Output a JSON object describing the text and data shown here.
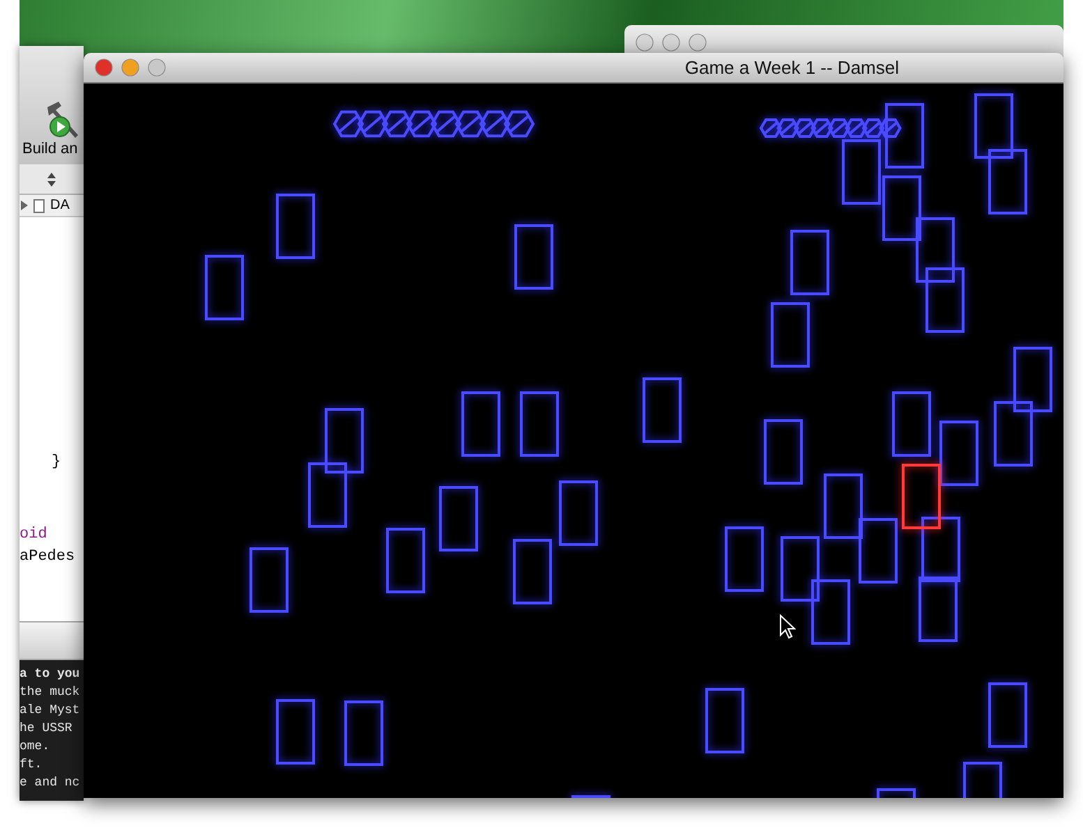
{
  "game_window": {
    "title": "Game a Week 1 -- Damsel"
  },
  "xcode_window": {
    "toolbar_label": "Build an",
    "file_row": "DA",
    "code_lines": [
      {
        "text": "}",
        "kind": "brace"
      },
      {
        "text": "oid",
        "kind": "keyword"
      },
      {
        "text": "aPedes",
        "kind": "plain"
      }
    ],
    "console_lines": [
      {
        "text": "a to you",
        "bold": true
      },
      {
        "text": "the muck",
        "bold": false
      },
      {
        "text": "ale Myst",
        "bold": false
      },
      {
        "text": "he USSR",
        "bold": false
      },
      {
        "text": "ome.",
        "bold": false
      },
      {
        "text": "ft.",
        "bold": false
      },
      {
        "text": "e and nc",
        "bold": false
      }
    ]
  }
}
